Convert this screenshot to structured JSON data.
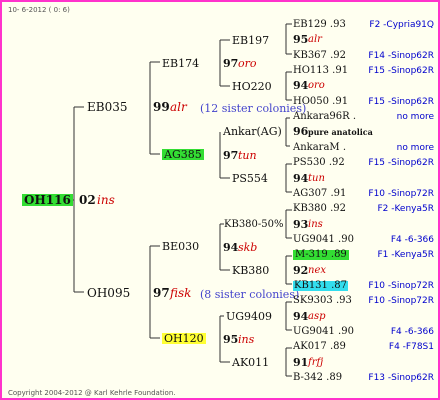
{
  "header": "10- 6-2012 ( 0: 6)",
  "footer": "Copyright 2004-2012 @ Karl Kehrle Foundation.",
  "root": {
    "id": "OH116",
    "year": "02",
    "breeder": "ins"
  },
  "gen1": [
    {
      "id": "EB035",
      "year": "99",
      "breeder": "alr",
      "sisters": "(12 sister colonies)"
    },
    {
      "id": "OH095",
      "year": "97",
      "breeder": "fisk",
      "sisters": "(8 sister colonies)"
    }
  ],
  "gen2": [
    {
      "id": "EB174"
    },
    {
      "id": "AG385"
    },
    {
      "id": "BE030"
    },
    {
      "id": "OH120"
    }
  ],
  "gen3": [
    {
      "id": "EB197",
      "year": "97",
      "breeder": "oro"
    },
    {
      "id": "HO220"
    },
    {
      "id": "Ankar(AG)",
      "year": "97",
      "breeder": "tun"
    },
    {
      "id": "PS554"
    },
    {
      "id": "KB380-50%",
      "year": "94",
      "breeder": "skb"
    },
    {
      "id": "KB380"
    },
    {
      "id": "UG9409",
      "year": "95",
      "breeder": "ins"
    },
    {
      "id": "AK011"
    }
  ],
  "gen4": [
    {
      "id": "EB129 .93",
      "ref": "F2 -Cypria91Q",
      "hl": ""
    },
    {
      "id": "95",
      "breeder": "alr",
      "year": true
    },
    {
      "id": "KB367 .92",
      "ref": "F14 -Sinop62R"
    },
    {
      "id": "HO113 .91",
      "ref": "F15 -Sinop62R"
    },
    {
      "id": "94",
      "breeder": "oro",
      "year": true
    },
    {
      "id": "HO050 .91",
      "ref": "F15 -Sinop62R"
    },
    {
      "id": "Ankara96R .",
      "ref": "no more"
    },
    {
      "id": "96",
      "breeder": "pure anatolica",
      "year": true,
      "plain": true
    },
    {
      "id": "AnkaraM .",
      "ref": "no more"
    },
    {
      "id": "PS530 .92",
      "ref": "F15 -Sinop62R"
    },
    {
      "id": "94",
      "breeder": "tun",
      "year": true
    },
    {
      "id": "AG307 .91",
      "ref": "F10 -Sinop72R"
    },
    {
      "id": "KB380 .92",
      "ref": "F2 -Kenya5R"
    },
    {
      "id": "93",
      "breeder": "ins",
      "year": true
    },
    {
      "id": "UG9041 .90",
      "ref": "F4 -6-366"
    },
    {
      "id": "M-319 .89",
      "ref": "F1 -Kenya5R",
      "hl": "green"
    },
    {
      "id": "92",
      "breeder": "nex",
      "year": true
    },
    {
      "id": "KB131 .87",
      "ref": "F10 -Sinop72R",
      "hl": "cyan"
    },
    {
      "id": "SK9303 .93",
      "ref": "F10 -Sinop72R"
    },
    {
      "id": "94",
      "breeder": "asp",
      "year": true
    },
    {
      "id": "UG9041 .90",
      "ref": "F4 -6-366"
    },
    {
      "id": "AK017 .89",
      "ref": "F4 -F78S1"
    },
    {
      "id": "91",
      "breeder": "frfj",
      "year": true
    },
    {
      "id": "B-342 .89",
      "ref": "F13 -Sinop62R"
    }
  ]
}
